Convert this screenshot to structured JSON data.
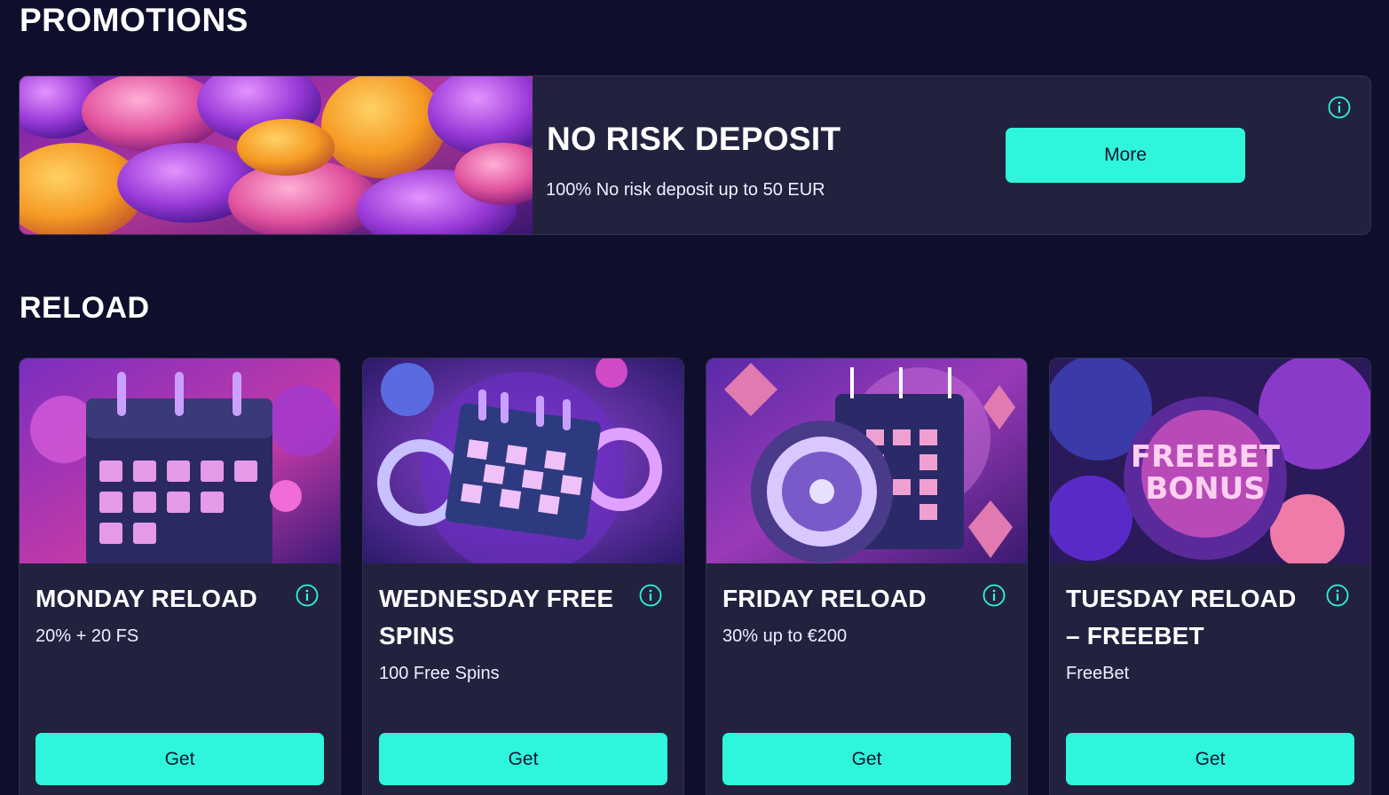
{
  "promotions": {
    "title": "PROMOTIONS",
    "featured": {
      "title": "NO RISK DEPOSIT",
      "description": "100% No risk deposit up to 50 EUR",
      "button_label": "More",
      "info_icon": "info-icon"
    }
  },
  "reload": {
    "title": "RELOAD",
    "cards": [
      {
        "title": "MONDAY RELOAD",
        "description": "20% + 20 FS",
        "button_label": "Get"
      },
      {
        "title": "WEDNESDAY FREE SPINS",
        "description": "100 Free Spins",
        "button_label": "Get"
      },
      {
        "title": "FRIDAY RELOAD",
        "description": "30% up to €200",
        "button_label": "Get"
      },
      {
        "title": "TUESDAY RELOAD – FREEBET",
        "description": "FreeBet",
        "button_label": "Get",
        "image_text": [
          "FREEBET",
          "BONUS"
        ]
      }
    ]
  },
  "colors": {
    "background": "#0f0f2d",
    "card": "#22223f",
    "accent": "#2ef5dc",
    "button_text": "#141430"
  }
}
